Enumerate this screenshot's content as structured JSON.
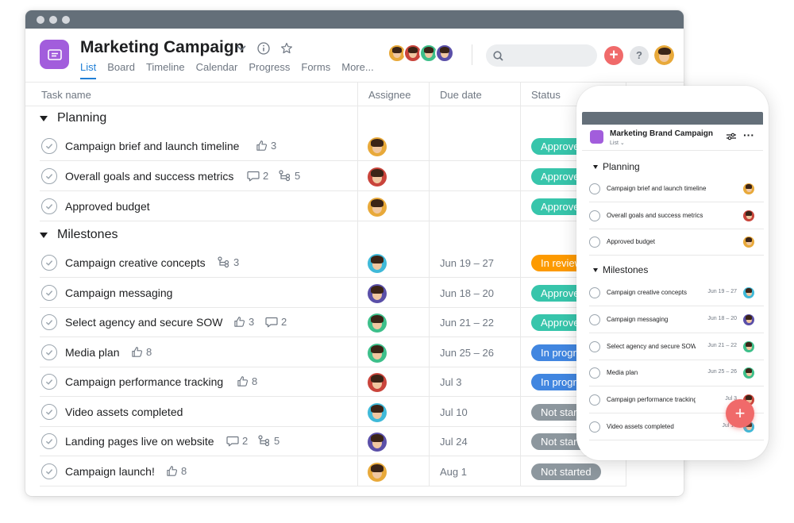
{
  "desktop": {
    "project_title": "Marketing Campaign",
    "tabs": [
      "List",
      "Board",
      "Timeline",
      "Calendar",
      "Progress",
      "Forms",
      "More..."
    ],
    "columns": {
      "task": "Task name",
      "assignee": "Assignee",
      "due": "Due date",
      "status": "Status"
    },
    "sections": [
      {
        "name": "Planning"
      },
      {
        "name": "Milestones"
      }
    ],
    "tasks": [
      {
        "name": "Campaign brief and launch timeline",
        "likes": "3",
        "comments": "",
        "subtasks": "",
        "due": "",
        "status": "Approved",
        "status_color": "#37c5ab",
        "assignee_color": "#e8a93a"
      },
      {
        "name": "Overall goals and success metrics",
        "likes": "",
        "comments": "2",
        "subtasks": "5",
        "due": "",
        "status": "Approved",
        "status_color": "#37c5ab",
        "assignee_color": "#c9443b"
      },
      {
        "name": "Approved budget",
        "likes": "",
        "comments": "",
        "subtasks": "",
        "due": "",
        "status": "Approved",
        "status_color": "#37c5ab",
        "assignee_color": "#e8a93a"
      },
      {
        "name": "Campaign creative concepts",
        "likes": "",
        "comments": "",
        "subtasks": "3",
        "due": "Jun 19 – 27",
        "status": "In review",
        "status_color": "#fd9a00",
        "assignee_color": "#3fb9d8"
      },
      {
        "name": "Campaign messaging",
        "likes": "",
        "comments": "",
        "subtasks": "",
        "due": "Jun 18 – 20",
        "status": "Approved",
        "status_color": "#37c5ab",
        "assignee_color": "#5a4fa8"
      },
      {
        "name": "Select agency and secure SOW",
        "likes": "3",
        "comments": "2",
        "subtasks": "",
        "due": "Jun 21 – 22",
        "status": "Approved",
        "status_color": "#37c5ab",
        "assignee_color": "#3dbf8a"
      },
      {
        "name": "Media plan",
        "likes": "8",
        "comments": "",
        "subtasks": "",
        "due": "Jun 25 – 26",
        "status": "In progress",
        "status_color": "#4186e0",
        "assignee_color": "#3dbf8a"
      },
      {
        "name": "Campaign performance tracking",
        "likes": "8",
        "comments": "",
        "subtasks": "",
        "due": "Jul 3",
        "status": "In progress",
        "status_color": "#4186e0",
        "assignee_color": "#c9443b"
      },
      {
        "name": "Video assets completed",
        "likes": "",
        "comments": "",
        "subtasks": "",
        "due": "Jul 10",
        "status": "Not started",
        "status_color": "#8d979e",
        "assignee_color": "#3fb9d8"
      },
      {
        "name": "Landing pages live on website",
        "likes": "",
        "comments": "2",
        "subtasks": "5",
        "due": "Jul 24",
        "status": "Not started",
        "status_color": "#8d979e",
        "assignee_color": "#5a4fa8"
      },
      {
        "name": "Campaign launch!",
        "likes": "8",
        "comments": "",
        "subtasks": "",
        "due": "Aug 1",
        "status": "Not started",
        "status_color": "#8d979e",
        "assignee_color": "#e8a93a"
      }
    ],
    "header_avatar_colors": [
      "#e8a93a",
      "#c9443b",
      "#3dbf8a",
      "#5a4fa8"
    ],
    "me_avatar_color": "#e8a93a",
    "accent_color": "#1f7fd6",
    "add_button_color": "#f06a6a"
  },
  "mobile": {
    "project_title": "Marketing Brand Campaign",
    "view_label": "List",
    "sections": [
      "Planning",
      "Milestones"
    ],
    "tasks": [
      {
        "name": "Campaign brief and launch timeline",
        "due": "",
        "assignee_color": "#e8a93a"
      },
      {
        "name": "Overall goals and success metrics",
        "due": "",
        "assignee_color": "#c9443b"
      },
      {
        "name": "Approved budget",
        "due": "",
        "assignee_color": "#e8a93a"
      },
      {
        "name": "Campaign creative concepts",
        "due": "Jun 19 – 27",
        "assignee_color": "#3fb9d8"
      },
      {
        "name": "Campaign messaging",
        "due": "Jun 18 – 20",
        "assignee_color": "#5a4fa8"
      },
      {
        "name": "Select agency and secure SOW",
        "due": "Jun 21 – 22",
        "assignee_color": "#3dbf8a"
      },
      {
        "name": "Media plan",
        "due": "Jun 25 – 26",
        "assignee_color": "#3dbf8a"
      },
      {
        "name": "Campaign performance tracking",
        "due": "Jul 3",
        "assignee_color": "#c9443b"
      },
      {
        "name": "Video assets completed",
        "due": "Jul 10",
        "assignee_color": "#3fb9d8"
      }
    ]
  }
}
